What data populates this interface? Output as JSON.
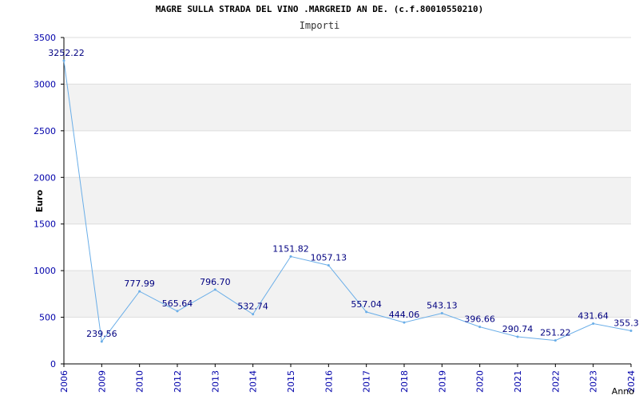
{
  "chart_data": {
    "type": "line",
    "title": "MAGRE SULLA STRADA DEL VINO .MARGREID AN DE. (c.f.80010550210)",
    "subtitle": "Importi",
    "xlabel": "Anno",
    "ylabel": "Euro",
    "categories": [
      "2006",
      "2009",
      "2010",
      "2012",
      "2013",
      "2014",
      "2015",
      "2016",
      "2017",
      "2018",
      "2019",
      "2020",
      "2021",
      "2022",
      "2023",
      "2024"
    ],
    "series": [
      {
        "values": [
          3252.22,
          239.56,
          777.99,
          565.64,
          796.7,
          532.74,
          1151.82,
          1057.13,
          557.04,
          444.06,
          543.13,
          396.66,
          290.74,
          251.22,
          431.64,
          355.3
        ],
        "labels": [
          "3252.22",
          "239.56",
          "777.99",
          "565.64",
          "796.70",
          "532.74",
          "1151.82",
          "1057.13",
          "557.04",
          "444.06",
          "543.13",
          "396.66",
          "290.74",
          "251.22",
          "431.64",
          "355.3"
        ]
      }
    ],
    "ylim": [
      0,
      3500
    ],
    "yticks": [
      "0",
      "500",
      "1000",
      "1500",
      "2000",
      "2500",
      "3000",
      "3500"
    ],
    "grid": true,
    "colors": {
      "line": "#6aaee8",
      "band": "#f2f2f2",
      "gridline": "#dddddd",
      "tick_label": "#0000aa",
      "data_label": "#000080",
      "axis": "#000000"
    }
  }
}
